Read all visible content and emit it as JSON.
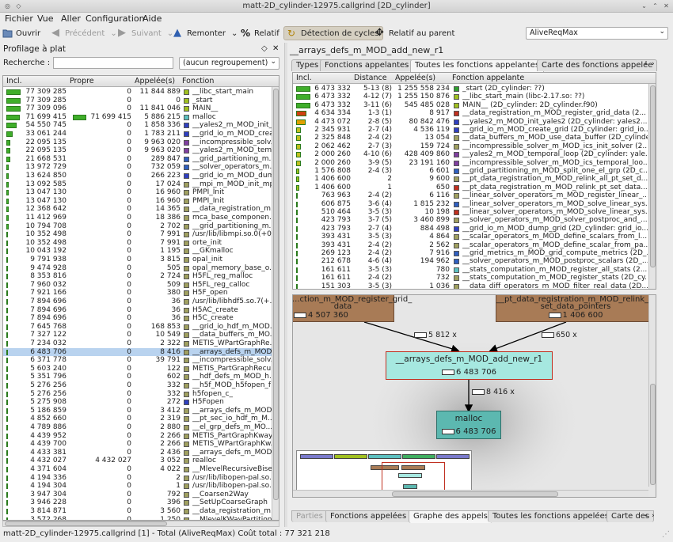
{
  "window": {
    "title": "matt-2D_cylinder-12975.callgrind [2D_cylinder]"
  },
  "menu": [
    "Fichier",
    "Vue",
    "Aller",
    "Configuration",
    "Aide"
  ],
  "toolbar": {
    "open": "Ouvrir",
    "back": "Précédent",
    "forward": "Suivant",
    "up": "Remonter",
    "relative": "Relatif",
    "cycle": "Détection de cycles",
    "relative_parent": "Relatif au parent",
    "event": "AliveReqMax"
  },
  "left": {
    "title": "Profilage à plat",
    "search_label": "Recherche :",
    "search_value": "",
    "grouping": "(aucun regroupement)",
    "headers": [
      "Incl.",
      "Propre",
      "Appelée(s)",
      "Fonction"
    ],
    "rows": [
      {
        "incl": "77 309 285",
        "self": "0",
        "called": "11 844 889",
        "fn": "__libc_start_main",
        "c": "#a0c020",
        "b": 1.0
      },
      {
        "incl": "77 309 285",
        "self": "0",
        "called": "0",
        "fn": "_start",
        "c": "#a0c020",
        "b": 1.0
      },
      {
        "incl": "77 309 096",
        "self": "0",
        "called": "11 841 046",
        "fn": "MAIN__",
        "c": "#a0c020",
        "b": 1.0
      },
      {
        "incl": "71 699 415",
        "self": "71 699 415",
        "called": "5 886 215",
        "fn": "malloc",
        "c": "#5cc0c0",
        "b": 0.93,
        "sb": 0.93
      },
      {
        "incl": "54 550 745",
        "self": "0",
        "called": "1 858 336",
        "fn": "__yales2_m_MOD_init_...",
        "c": "#3040c0",
        "b": 0.7
      },
      {
        "incl": "33 061 244",
        "self": "0",
        "called": "1 783 211",
        "fn": "__grid_io_m_MOD_crea...",
        "c": "#3040c0",
        "b": 0.43
      },
      {
        "incl": "22 095 135",
        "self": "0",
        "called": "9 963 020",
        "fn": "__incompressible_solv...",
        "c": "#8040a0",
        "b": 0.29
      },
      {
        "incl": "22 095 135",
        "self": "0",
        "called": "9 963 020",
        "fn": "__yales2_m_MOD_tem...",
        "c": "#8040a0",
        "b": 0.29
      },
      {
        "incl": "21 668 531",
        "self": "0",
        "called": "289 847",
        "fn": "__grid_partitioning_m...",
        "c": "#3060c0",
        "b": 0.28
      },
      {
        "incl": "13 972 729",
        "self": "0",
        "called": "732 059",
        "fn": "__solver_operators_m...",
        "c": "#3060c0",
        "b": 0.18
      },
      {
        "incl": "13 624 850",
        "self": "0",
        "called": "266 223",
        "fn": "__grid_io_m_MOD_dum...",
        "c": "#3040c0",
        "b": 0.18
      },
      {
        "incl": "13 092 585",
        "self": "0",
        "called": "17 024",
        "fn": "__mpi_m_MOD_init_mp...",
        "c": "#a0a060",
        "b": 0.17
      },
      {
        "incl": "13 047 130",
        "self": "0",
        "called": "16 960",
        "fn": "PMPI_Init",
        "c": "#a0a060",
        "b": 0.17
      },
      {
        "incl": "13 047 130",
        "self": "0",
        "called": "16 960",
        "fn": "PMPI_Init",
        "c": "#a0a060",
        "b": 0.17
      },
      {
        "incl": "12 368 642",
        "self": "0",
        "called": "14 365",
        "fn": "__data_registration_m...",
        "c": "#a0a060",
        "b": 0.16
      },
      {
        "incl": "11 412 969",
        "self": "0",
        "called": "18 386",
        "fn": "mca_base_componen...",
        "c": "#a0a060",
        "b": 0.15
      },
      {
        "incl": "10 794 708",
        "self": "0",
        "called": "2 702",
        "fn": "__grid_partitioning_m...",
        "c": "#a0a060",
        "b": 0.14
      },
      {
        "incl": "10 352 498",
        "self": "0",
        "called": "7 991",
        "fn": "/usr/lib/libmpi.so.0(+0...",
        "c": "#a0a060",
        "b": 0.13
      },
      {
        "incl": "10 352 498",
        "self": "0",
        "called": "7 991",
        "fn": "orte_init",
        "c": "#a0a060",
        "b": 0.13
      },
      {
        "incl": "10 043 192",
        "self": "0",
        "called": "1 195",
        "fn": "__GKmalloc",
        "c": "#a0a060",
        "b": 0.13
      },
      {
        "incl": "9 791 938",
        "self": "0",
        "called": "3 815",
        "fn": "opal_init",
        "c": "#a0a060",
        "b": 0.13
      },
      {
        "incl": "9 474 928",
        "self": "0",
        "called": "505",
        "fn": "opal_memory_base_o...",
        "c": "#a0a060",
        "b": 0.12
      },
      {
        "incl": "8 353 816",
        "self": "0",
        "called": "2 724",
        "fn": "H5FL_reg_malloc",
        "c": "#a0a060",
        "b": 0.11
      },
      {
        "incl": "7 960 032",
        "self": "0",
        "called": "509",
        "fn": "H5FL_reg_calloc",
        "c": "#a0a060",
        "b": 0.1
      },
      {
        "incl": "7 921 166",
        "self": "0",
        "called": "380",
        "fn": "H5F_open",
        "c": "#a0a060",
        "b": 0.1
      },
      {
        "incl": "7 894 696",
        "self": "0",
        "called": "36",
        "fn": "/usr/lib/libhdf5.so.7(+...",
        "c": "#a0a060",
        "b": 0.1
      },
      {
        "incl": "7 894 696",
        "self": "0",
        "called": "36",
        "fn": "H5AC_create",
        "c": "#a0a060",
        "b": 0.1
      },
      {
        "incl": "7 894 696",
        "self": "0",
        "called": "36",
        "fn": "H5C_create",
        "c": "#a0a060",
        "b": 0.1
      },
      {
        "incl": "7 645 768",
        "self": "0",
        "called": "168 853",
        "fn": "__grid_io_hdf_m_MOD...",
        "c": "#a0a060",
        "b": 0.1
      },
      {
        "incl": "7 327 122",
        "self": "0",
        "called": "10 549",
        "fn": "__data_buffers_m_MO...",
        "c": "#a0a060",
        "b": 0.09
      },
      {
        "incl": "7 234 032",
        "self": "0",
        "called": "2 322",
        "fn": "METIS_WPartGraphRe...",
        "c": "#a0a060",
        "b": 0.09
      },
      {
        "incl": "6 483 706",
        "self": "0",
        "called": "8 416",
        "fn": "__arrays_defs_m_MOD...",
        "c": "#a0a060",
        "b": 0.08,
        "sel": true
      },
      {
        "incl": "6 371 778",
        "self": "0",
        "called": "39 791",
        "fn": "__incompressible_solv...",
        "c": "#a0a060",
        "b": 0.08
      },
      {
        "incl": "5 603 240",
        "self": "0",
        "called": "122",
        "fn": "METIS_PartGraphRecu...",
        "c": "#a0a060",
        "b": 0.07
      },
      {
        "incl": "5 351 796",
        "self": "0",
        "called": "602",
        "fn": "__hdf_defs_m_MOD_h...",
        "c": "#a0a060",
        "b": 0.07
      },
      {
        "incl": "5 276 256",
        "self": "0",
        "called": "332",
        "fn": "__h5f_MOD_h5fopen_f",
        "c": "#a0a060",
        "b": 0.07
      },
      {
        "incl": "5 276 256",
        "self": "0",
        "called": "332",
        "fn": "h5fopen_c_",
        "c": "#a0a060",
        "b": 0.07
      },
      {
        "incl": "5 275 908",
        "self": "0",
        "called": "272",
        "fn": "H5Fopen",
        "c": "#3040c0",
        "b": 0.07
      },
      {
        "incl": "5 186 859",
        "self": "0",
        "called": "3 412",
        "fn": "__arrays_defs_m_MOD...",
        "c": "#a0a060",
        "b": 0.07
      },
      {
        "incl": "4 852 660",
        "self": "0",
        "called": "2 319",
        "fn": "__pt_sec_io_hdf_m_M...",
        "c": "#a0a060",
        "b": 0.06
      },
      {
        "incl": "4 789 886",
        "self": "0",
        "called": "2 880",
        "fn": "__el_grp_defs_m_MO...",
        "c": "#a0a060",
        "b": 0.06
      },
      {
        "incl": "4 439 952",
        "self": "0",
        "called": "2 266",
        "fn": "METIS_PartGraphKway",
        "c": "#a0a060",
        "b": 0.06
      },
      {
        "incl": "4 439 700",
        "self": "0",
        "called": "2 266",
        "fn": "METIS_WPartGraphKw...",
        "c": "#a0a060",
        "b": 0.06
      },
      {
        "incl": "4 433 381",
        "self": "0",
        "called": "2 436",
        "fn": "__arrays_defs_m_MOD...",
        "c": "#a0a060",
        "b": 0.06
      },
      {
        "incl": "4 432 027",
        "self": "4 432 027",
        "called": "3 052",
        "fn": "realloc",
        "c": "#a0a060",
        "b": 0.06
      },
      {
        "incl": "4 371 604",
        "self": "0",
        "called": "4 022",
        "fn": "__MlevelRecursiveBise...",
        "c": "#a0a060",
        "b": 0.06
      },
      {
        "incl": "4 194 336",
        "self": "0",
        "called": "2",
        "fn": "/usr/lib/libopen-pal.so...",
        "c": "#a0a060",
        "b": 0.05
      },
      {
        "incl": "4 194 304",
        "self": "0",
        "called": "1",
        "fn": "/usr/lib/libopen-pal.so...",
        "c": "#a0a060",
        "b": 0.05
      },
      {
        "incl": "3 947 304",
        "self": "0",
        "called": "792",
        "fn": "__Coarsen2Way",
        "c": "#a0a060",
        "b": 0.05
      },
      {
        "incl": "3 946 228",
        "self": "0",
        "called": "396",
        "fn": "__SetUpCoarseGraph",
        "c": "#a0a060",
        "b": 0.05
      },
      {
        "incl": "3 814 871",
        "self": "0",
        "called": "3 560",
        "fn": "__data_registration_m...",
        "c": "#a0a060",
        "b": 0.05
      },
      {
        "incl": "3 572 268",
        "self": "0",
        "called": "1 250",
        "fn": "__MlevelKWayPartition...",
        "c": "#a0a060",
        "b": 0.05
      }
    ]
  },
  "right": {
    "title": "__arrays_defs_m_MOD_add_new_r1",
    "tabs_top": [
      "Types",
      "Fonctions appelantes",
      "Toutes les fonctions appelantes",
      "Carte des fonctions appelée"
    ],
    "headers": [
      "Incl.",
      "Distance",
      "Appelée(s)",
      "Fonction appelante"
    ],
    "rows": [
      {
        "incl": "6 473 332",
        "dist": "5-13 (8)",
        "called": "1 255 558 234",
        "fn": "_start (2D_cylinder: ??)",
        "c": "#30a030",
        "b": 1.0
      },
      {
        "incl": "6 473 332",
        "dist": "4-12 (7)",
        "called": "1 255 150 876",
        "fn": "__libc_start_main (libc-2.17.so: ??)",
        "c": "#a0c020",
        "b": 1.0
      },
      {
        "incl": "6 473 332",
        "dist": "3-11 (6)",
        "called": "545 485 028",
        "fn": "MAIN__ (2D_cylinder: 2D_cylinder.f90)",
        "c": "#a0c020",
        "b": 1.0
      },
      {
        "incl": "4 634 334",
        "dist": "1-3 (1)",
        "called": "8 917",
        "fn": "__data_registration_m_MOD_register_grid_data (2...",
        "c": "#c03020",
        "b": 0.72
      },
      {
        "incl": "4 473 072",
        "dist": "2-8 (5)",
        "called": "80 842 476",
        "fn": "__yales2_m_MOD_init_yales2 (2D_cylinder: yales2...",
        "c": "#3040c0",
        "b": 0.69
      },
      {
        "incl": "2 345 931",
        "dist": "2-7 (4)",
        "called": "4 536 119",
        "fn": "__grid_io_m_MOD_create_grid (2D_cylinder: grid_io...",
        "c": "#3040c0",
        "b": 0.36
      },
      {
        "incl": "2 325 848",
        "dist": "2-4 (2)",
        "called": "13 054",
        "fn": "__data_buffers_m_MOD_use_data_buffer (2D_cylinde...",
        "c": "#a0a060",
        "b": 0.36
      },
      {
        "incl": "2 062 462",
        "dist": "2-7 (3)",
        "called": "159 724",
        "fn": "__incompressible_solver_m_MOD_ics_init_solver (2...",
        "c": "#a0a060",
        "b": 0.32
      },
      {
        "incl": "2 000 260",
        "dist": "4-10 (6)",
        "called": "428 409 860",
        "fn": "__yales2_m_MOD_temporal_loop (2D_cylinder: yale...",
        "c": "#8040a0",
        "b": 0.31
      },
      {
        "incl": "2 000 260",
        "dist": "3-9 (5)",
        "called": "23 191 160",
        "fn": "__incompressible_solver_m_MOD_ics_temporal_loo...",
        "c": "#8040a0",
        "b": 0.31
      },
      {
        "incl": "1 576 808",
        "dist": "2-4 (3)",
        "called": "6 601",
        "fn": "__grid_partitioning_m_MOD_split_one_el_grp (2D_c...",
        "c": "#3060c0",
        "b": 0.24
      },
      {
        "incl": "1 406 600",
        "dist": "2",
        "called": "9 600",
        "fn": "__pt_data_registration_m_MOD_relink_all_pt_set_d...",
        "c": "#a0a060",
        "b": 0.22
      },
      {
        "incl": "1 406 600",
        "dist": "1",
        "called": "650",
        "fn": "__pt_data_registration_m_MOD_relink_pt_set_data...",
        "c": "#c03020",
        "b": 0.22
      },
      {
        "incl": "763 963",
        "dist": "2-4 (2)",
        "called": "6 116",
        "fn": "__linear_solver_operators_m_MOD_register_linear_...",
        "c": "#a0a060",
        "b": 0.12
      },
      {
        "incl": "606 875",
        "dist": "3-6 (4)",
        "called": "1 815 232",
        "fn": "__linear_solver_operators_m_MOD_solve_linear_sys...",
        "c": "#3060c0",
        "b": 0.09
      },
      {
        "incl": "510 464",
        "dist": "3-5 (3)",
        "called": "10 198",
        "fn": "__linear_solver_operators_m_MOD_solve_linear_sys...",
        "c": "#c03020",
        "b": 0.08
      },
      {
        "incl": "423 793",
        "dist": "3-7 (5)",
        "called": "3 460 899",
        "fn": "__solver_operators_m_MOD_solver_postproc_and_...",
        "c": "#a0a060",
        "b": 0.07
      },
      {
        "incl": "423 793",
        "dist": "2-7 (4)",
        "called": "884 498",
        "fn": "__grid_io_m_MOD_dump_grid (2D_cylinder: grid_io...",
        "c": "#3040c0",
        "b": 0.07
      },
      {
        "incl": "393 431",
        "dist": "3-5 (3)",
        "called": "4 864",
        "fn": "__scalar_operators_m_MOD_define_scalars_from_l...",
        "c": "#a0a060",
        "b": 0.06
      },
      {
        "incl": "393 431",
        "dist": "2-4 (2)",
        "called": "2 562",
        "fn": "__scalar_operators_m_MOD_define_scalar_from_pa...",
        "c": "#a0a060",
        "b": 0.06
      },
      {
        "incl": "269 123",
        "dist": "2-4 (2)",
        "called": "7 916",
        "fn": "__grid_metrics_m_MOD_grid_compute_metrics (2D_...",
        "c": "#3060c0",
        "b": 0.04
      },
      {
        "incl": "212 678",
        "dist": "4-6 (4)",
        "called": "194 962",
        "fn": "__solver_operators_m_MOD_postproc_scalars (2D_...",
        "c": "#3060c0",
        "b": 0.03
      },
      {
        "incl": "161 611",
        "dist": "3-5 (3)",
        "called": "780",
        "fn": "__stats_computation_m_MOD_register_all_stats (2...",
        "c": "#5cc0c0",
        "b": 0.03
      },
      {
        "incl": "161 611",
        "dist": "2-4 (2)",
        "called": "732",
        "fn": "__stats_computation_m_MOD_register_stats (2D_cy...",
        "c": "#a0a060",
        "b": 0.03
      },
      {
        "incl": "151 303",
        "dist": "3-5 (3)",
        "called": "1 036",
        "fn": "__data_diff_operators_m_MOD_filter_real_data (2D...",
        "c": "#a0a060",
        "b": 0.02
      }
    ],
    "graph": {
      "node_left": {
        "label1": "...ction_m_MOD_register_grid_",
        "label2": "data",
        "cost": "4 507 360"
      },
      "node_right": {
        "label1": "__pt_data_registration_m_MOD_relink_pt_",
        "label2": "set_data_pointers",
        "cost": "1 406 600"
      },
      "edge_left": "5 812 x",
      "edge_right": "650 x",
      "node_center": {
        "label": "__arrays_defs_m_MOD_add_new_r1",
        "cost": "6 483 706"
      },
      "edge_down": "8 416 x",
      "node_bottom": {
        "label": "malloc",
        "cost": "6 483 706"
      }
    },
    "tabs_bottom": [
      "Parties",
      "Fonctions appelées",
      "Graphe des appels",
      "Toutes les fonctions appelées",
      "Carte des"
    ]
  },
  "status": "matt-2D_cylinder-12975.callgrind [1] - Total (AliveReqMax) Coût total : 77 321 218"
}
